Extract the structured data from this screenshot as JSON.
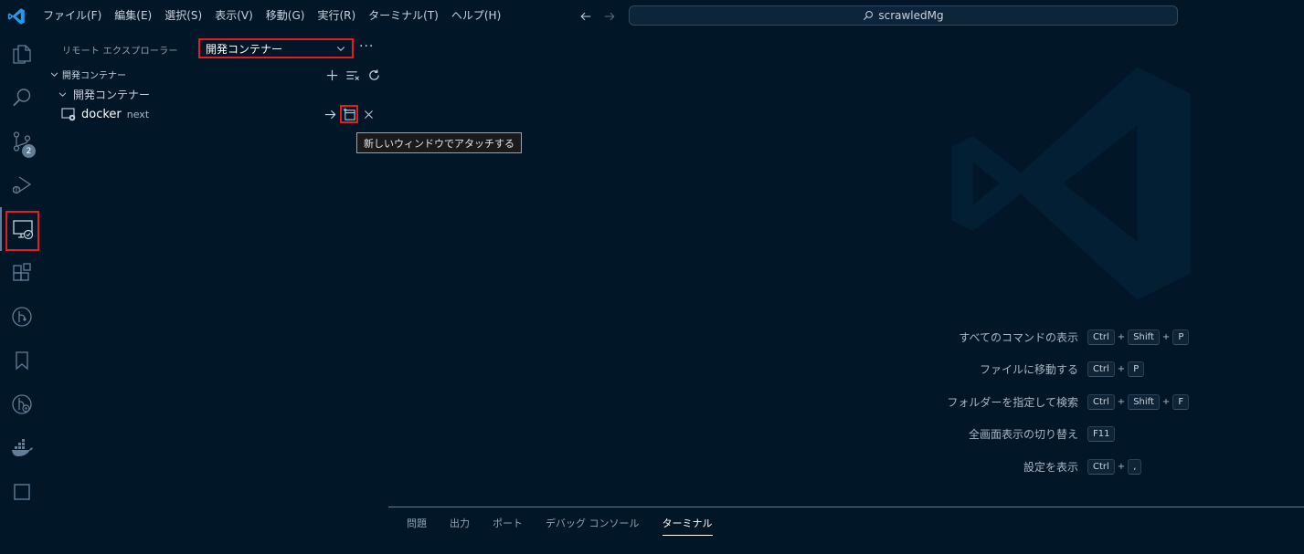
{
  "titlebar": {
    "menu": [
      "ファイル(F)",
      "編集(E)",
      "選択(S)",
      "表示(V)",
      "移動(G)",
      "実行(R)",
      "ターミナル(T)",
      "ヘルプ(H)"
    ],
    "search_text": "scrawledMg"
  },
  "activitybar": {
    "items": [
      "explorer-icon",
      "search-icon",
      "source-control-icon",
      "run-debug-icon",
      "remote-explorer-icon",
      "extensions-icon",
      "git-graph-icon",
      "bookmarks-icon",
      "gitlens-icon",
      "docker-icon",
      "square-icon"
    ],
    "source_control_badge": "2"
  },
  "sidebar": {
    "title": "リモート エクスプローラー",
    "selector_value": "開発コンテナー",
    "more": "···",
    "section_label": "開発コンテナー",
    "group_label": "開発コンテナー",
    "item": {
      "name": "docker",
      "description": "next"
    },
    "tooltip": "新しいウィンドウでアタッチする"
  },
  "editor": {
    "shortcuts": [
      {
        "label": "すべてのコマンドの表示",
        "keys": [
          "Ctrl",
          "Shift",
          "P"
        ]
      },
      {
        "label": "ファイルに移動する",
        "keys": [
          "Ctrl",
          "P"
        ]
      },
      {
        "label": "フォルダーを指定して検索",
        "keys": [
          "Ctrl",
          "Shift",
          "F"
        ]
      },
      {
        "label": "全画面表示の切り替え",
        "keys": [
          "F11"
        ]
      },
      {
        "label": "設定を表示",
        "keys": [
          "Ctrl",
          ","
        ]
      }
    ]
  },
  "panel": {
    "tabs": [
      "問題",
      "出力",
      "ポート",
      "デバッグ コンソール",
      "ターミナル"
    ],
    "active_tab": "ターミナル"
  },
  "colors": {
    "background": "#011627",
    "accent": "#5f7e97",
    "highlight": "#e02020",
    "logo": "#1f9cf0"
  }
}
